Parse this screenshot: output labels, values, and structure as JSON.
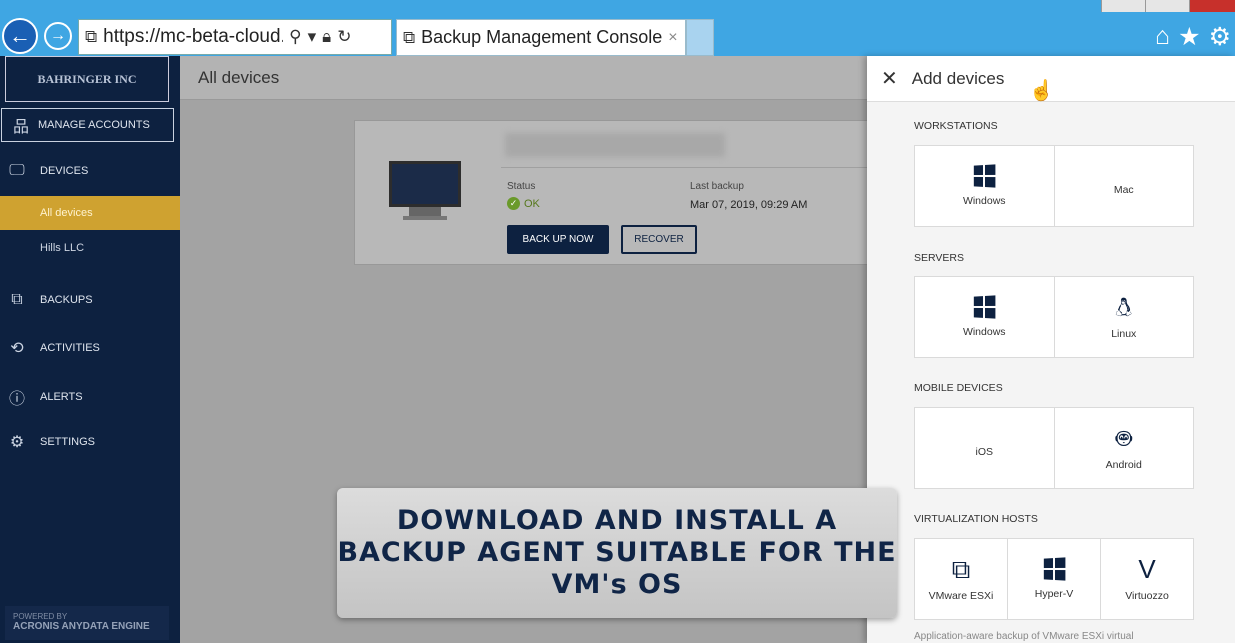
{
  "browser": {
    "url": "https://mc-beta-cloud.a",
    "tab_title": "Backup Management Console",
    "tab_close": "×"
  },
  "sidebar": {
    "logo": "BAHRINGER INC",
    "manage_accounts": "MANAGE ACCOUNTS",
    "items": [
      {
        "label": "DEVICES",
        "icon": "monitor-icon"
      },
      {
        "label": "BACKUPS",
        "icon": "backups-icon"
      },
      {
        "label": "ACTIVITIES",
        "icon": "activities-icon"
      },
      {
        "label": "ALERTS",
        "icon": "alert-icon"
      },
      {
        "label": "SETTINGS",
        "icon": "gear-icon"
      }
    ],
    "subitems": [
      {
        "label": "All devices",
        "active": true
      },
      {
        "label": "Hills LLC",
        "active": false
      }
    ],
    "powered_by": "POWERED BY",
    "engine": "ACRONIS ANYDATA ENGINE"
  },
  "main": {
    "title": "All devices",
    "card": {
      "status_label": "Status",
      "status_value": "OK",
      "last_backup_label": "Last backup",
      "last_backup_value": "Mar 07, 2019, 09:29 AM",
      "backup_now": "BACK UP NOW",
      "recover": "RECOVER"
    }
  },
  "panel": {
    "close": "✕",
    "title": "Add devices",
    "sections": [
      {
        "title": "WORKSTATIONS",
        "tiles": [
          {
            "label": "Windows",
            "icon": "windows-icon"
          },
          {
            "label": "Mac",
            "icon": "apple-icon"
          }
        ]
      },
      {
        "title": "SERVERS",
        "tiles": [
          {
            "label": "Windows",
            "icon": "windows-icon"
          },
          {
            "label": "Linux",
            "icon": "linux-icon"
          }
        ]
      },
      {
        "title": "MOBILE DEVICES",
        "tiles": [
          {
            "label": "iOS",
            "icon": "apple-icon"
          },
          {
            "label": "Android",
            "icon": "android-icon"
          }
        ]
      },
      {
        "title": "VIRTUALIZATION HOSTS",
        "tiles": [
          {
            "label": "VMware ESXi",
            "icon": "vmware-icon"
          },
          {
            "label": "Hyper-V",
            "icon": "windows-icon"
          },
          {
            "label": "Virtuozzo",
            "icon": "virtuozzo-icon"
          }
        ]
      }
    ],
    "footer_note": "Application-aware backup of VMware ESXi virtual"
  },
  "banner": {
    "line1": "DOWNLOAD AND INSTALL A",
    "line2": "BACKUP AGENT SUITABLE FOR THE",
    "line3": "VM's OS"
  }
}
